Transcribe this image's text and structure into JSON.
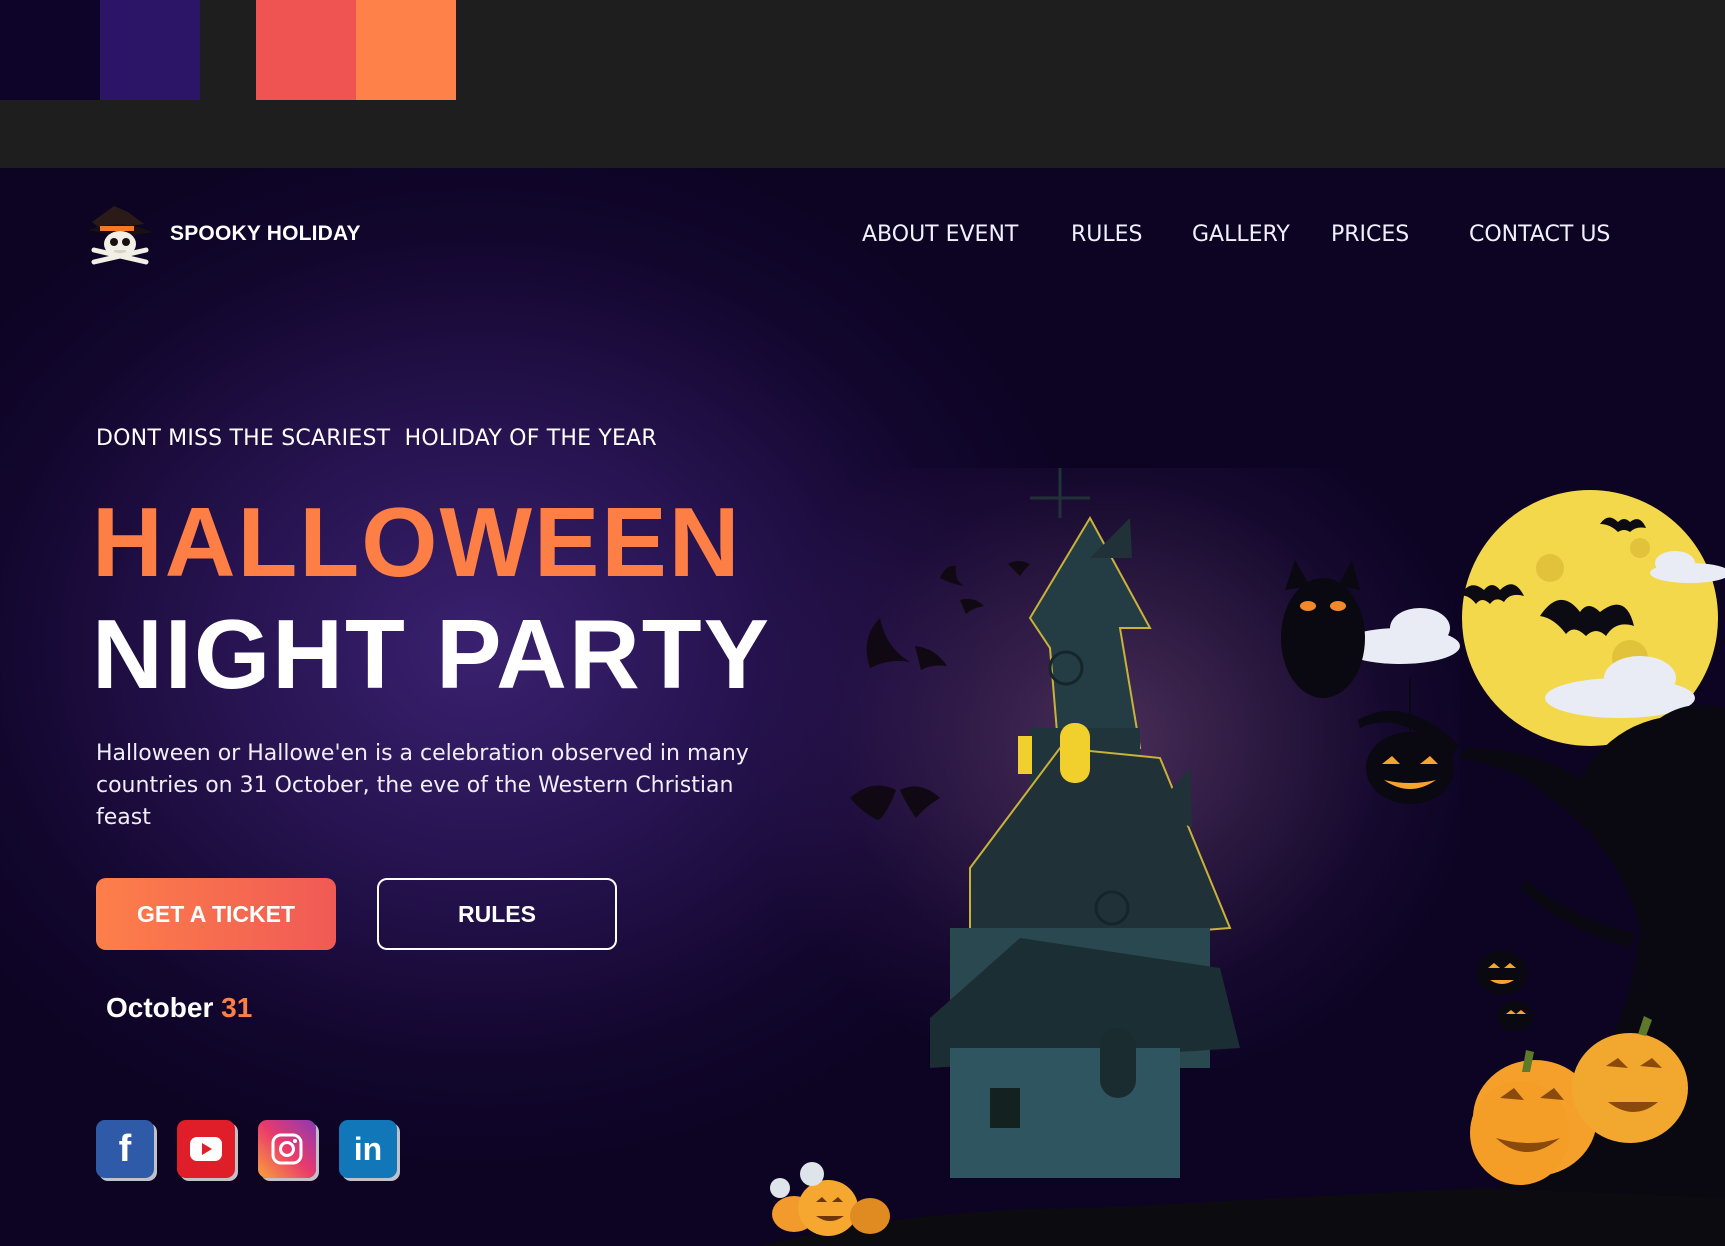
{
  "palette": {
    "colors": [
      "#0e0429",
      "#2c1467",
      "#ef5453",
      "#fe8149"
    ]
  },
  "brand": {
    "name": "SPOOKY HOLIDAY",
    "logo_icon": "skull-with-witch-hat"
  },
  "nav": {
    "items": [
      {
        "label": "ABOUT EVENT"
      },
      {
        "label": "RULES"
      },
      {
        "label": "GALLERY"
      },
      {
        "label": "PRICES"
      },
      {
        "label": "CONTACT US"
      }
    ]
  },
  "hero": {
    "eyebrow": "DONT MISS THE SCARIEST  HOLIDAY OF THE YEAR",
    "title_line1": "HALLOWEEN",
    "title_line2": "NIGHT PARTY",
    "description": "Halloween or Hallowe'en is a celebration observed in many countries on 31 October, the eve of the Western Christian feast",
    "cta_primary": "GET A TICKET",
    "cta_secondary": "RULES",
    "date_month": "October",
    "date_day": "31",
    "colors": {
      "accent": "#fd7f45",
      "background": "#12062d"
    }
  },
  "socials": [
    {
      "name": "facebook-icon"
    },
    {
      "name": "youtube-icon"
    },
    {
      "name": "instagram-icon"
    },
    {
      "name": "linkedin-icon"
    }
  ]
}
